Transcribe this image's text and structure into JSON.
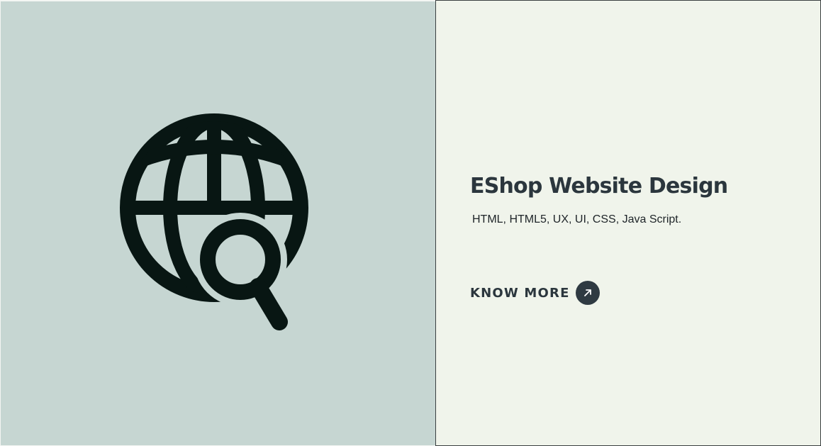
{
  "project": {
    "title": "EShop Website Design",
    "tags": "HTML, HTML5, UX, UI, CSS, Java Script.",
    "cta_label": "KNOW MORE"
  },
  "icons": {
    "hero": "globe-search-icon",
    "cta": "arrow-up-right-icon"
  },
  "colors": {
    "media_bg": "#c6d6d2",
    "content_bg": "#f0f4eb",
    "text_dark": "#2b363d",
    "icon_dark": "#081613"
  }
}
